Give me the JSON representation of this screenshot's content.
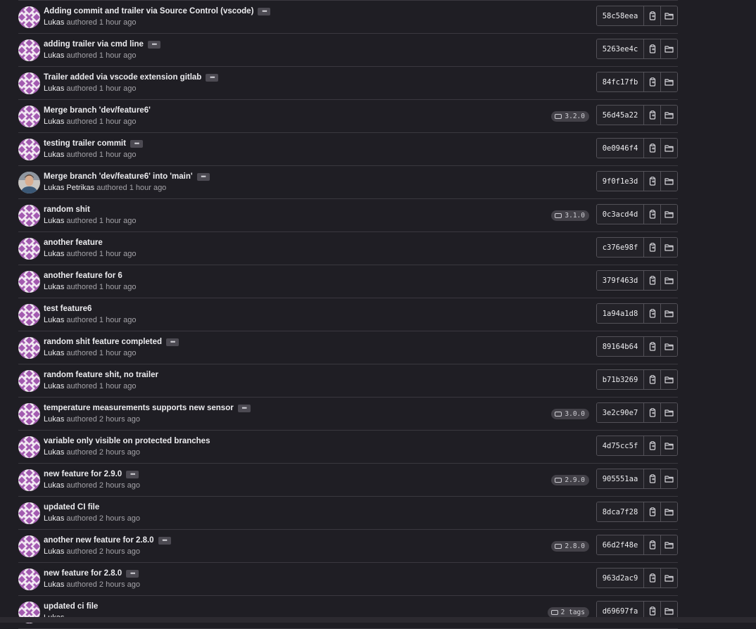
{
  "colors": {
    "background": "#1f1e24",
    "divider": "#3a383f",
    "text_primary": "#ececef",
    "text_secondary": "#a4a3a8",
    "avatar_pattern": "#a35bb0"
  },
  "icons": {
    "copy": "clipboard-copy-icon",
    "browse": "folder-icon",
    "tag": "tag-icon",
    "ellipsis": "ellipsis-icon"
  },
  "commits": [
    {
      "title": "Adding commit and trailer via Source Control (vscode)",
      "author": "Lukas",
      "authored": "authored 1 hour ago",
      "has_ellipsis": true,
      "tag": "",
      "sha": "58c58eea",
      "avatar": "identicon"
    },
    {
      "title": "adding trailer via cmd line",
      "author": "Lukas",
      "authored": "authored 1 hour ago",
      "has_ellipsis": true,
      "tag": "",
      "sha": "5263ee4c",
      "avatar": "identicon"
    },
    {
      "title": "Trailer added via vscode extension gitlab",
      "author": "Lukas",
      "authored": "authored 1 hour ago",
      "has_ellipsis": true,
      "tag": "",
      "sha": "84fc17fb",
      "avatar": "identicon"
    },
    {
      "title": "Merge branch 'dev/feature6'",
      "author": "Lukas",
      "authored": "authored 1 hour ago",
      "has_ellipsis": false,
      "tag": "3.2.0",
      "sha": "56d45a22",
      "avatar": "identicon"
    },
    {
      "title": "testing trailer commit",
      "author": "Lukas",
      "authored": "authored 1 hour ago",
      "has_ellipsis": true,
      "tag": "",
      "sha": "0e0946f4",
      "avatar": "identicon"
    },
    {
      "title": "Merge branch 'dev/feature6' into 'main'",
      "author": "Lukas Petrikas",
      "authored": "authored 1 hour ago",
      "has_ellipsis": true,
      "tag": "",
      "sha": "9f0f1e3d",
      "avatar": "photo"
    },
    {
      "title": "random shit",
      "author": "Lukas",
      "authored": "authored 1 hour ago",
      "has_ellipsis": false,
      "tag": "3.1.0",
      "sha": "0c3acd4d",
      "avatar": "identicon"
    },
    {
      "title": "another feature",
      "author": "Lukas",
      "authored": "authored 1 hour ago",
      "has_ellipsis": false,
      "tag": "",
      "sha": "c376e98f",
      "avatar": "identicon"
    },
    {
      "title": "another feature for 6",
      "author": "Lukas",
      "authored": "authored 1 hour ago",
      "has_ellipsis": false,
      "tag": "",
      "sha": "379f463d",
      "avatar": "identicon"
    },
    {
      "title": "test feature6",
      "author": "Lukas",
      "authored": "authored 1 hour ago",
      "has_ellipsis": false,
      "tag": "",
      "sha": "1a94a1d8",
      "avatar": "identicon"
    },
    {
      "title": "random shit feature completed",
      "author": "Lukas",
      "authored": "authored 1 hour ago",
      "has_ellipsis": true,
      "tag": "",
      "sha": "89164b64",
      "avatar": "identicon"
    },
    {
      "title": "random feature shit, no trailer",
      "author": "Lukas",
      "authored": "authored 1 hour ago",
      "has_ellipsis": false,
      "tag": "",
      "sha": "b71b3269",
      "avatar": "identicon"
    },
    {
      "title": "temperature measurements supports new sensor",
      "author": "Lukas",
      "authored": "authored 2 hours ago",
      "has_ellipsis": true,
      "tag": "3.0.0",
      "sha": "3e2c90e7",
      "avatar": "identicon"
    },
    {
      "title": "variable only visible on protected branches",
      "author": "Lukas",
      "authored": "authored 2 hours ago",
      "has_ellipsis": false,
      "tag": "",
      "sha": "4d75cc5f",
      "avatar": "identicon"
    },
    {
      "title": "new feature for 2.9.0",
      "author": "Lukas",
      "authored": "authored 2 hours ago",
      "has_ellipsis": true,
      "tag": "2.9.0",
      "sha": "905551aa",
      "avatar": "identicon"
    },
    {
      "title": "updated CI file",
      "author": "Lukas",
      "authored": "authored 2 hours ago",
      "has_ellipsis": false,
      "tag": "",
      "sha": "8dca7f28",
      "avatar": "identicon"
    },
    {
      "title": "another new feature for 2.8.0",
      "author": "Lukas",
      "authored": "authored 2 hours ago",
      "has_ellipsis": true,
      "tag": "2.8.0",
      "sha": "66d2f48e",
      "avatar": "identicon"
    },
    {
      "title": "new feature for 2.8.0",
      "author": "Lukas",
      "authored": "authored 2 hours ago",
      "has_ellipsis": true,
      "tag": "",
      "sha": "963d2ac9",
      "avatar": "identicon"
    },
    {
      "title": "updated ci file",
      "author": "Lukas",
      "authored": "",
      "has_ellipsis": false,
      "tag": "2 tags",
      "sha": "d69697fa",
      "avatar": "identicon"
    }
  ]
}
